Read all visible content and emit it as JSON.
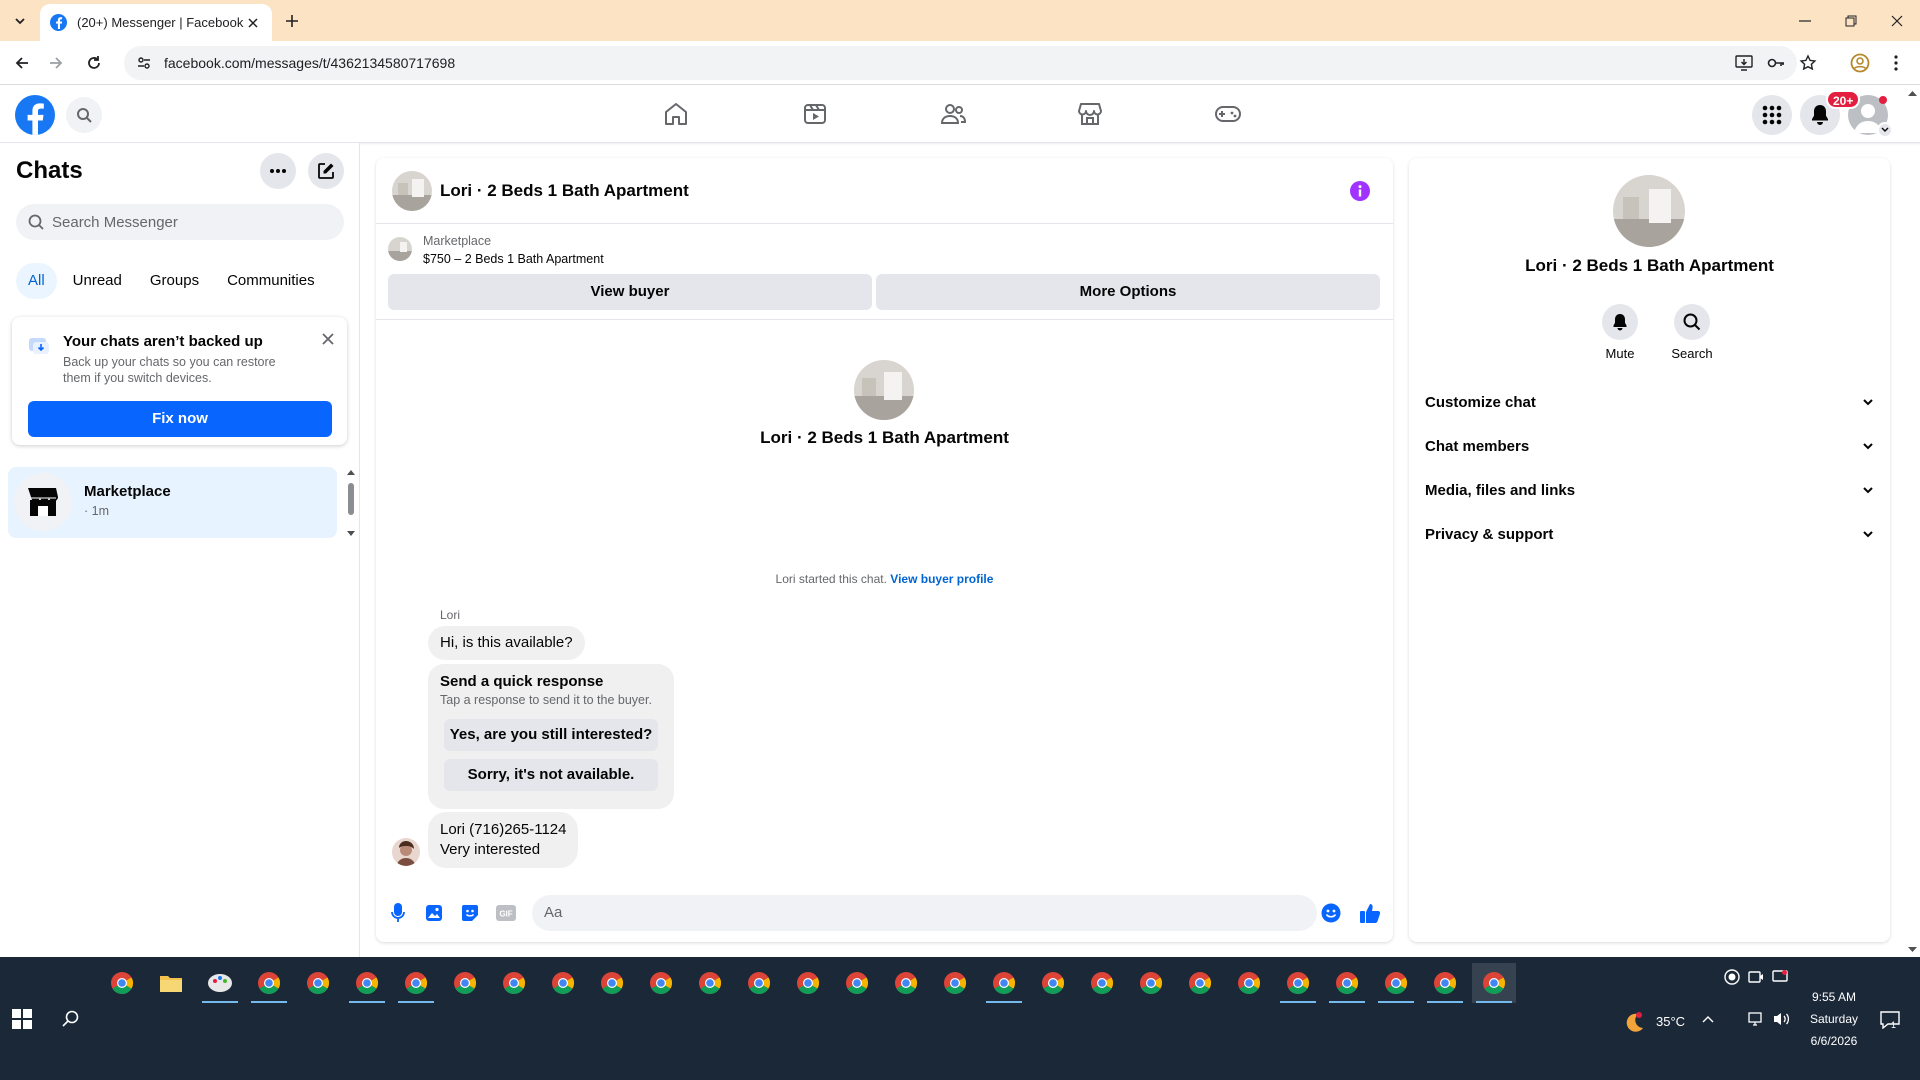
{
  "browser": {
    "tab_title": "(20+) Messenger | Facebook",
    "url": "facebook.com/messages/t/4362134580717698"
  },
  "header": {
    "notification_badge": "20+",
    "nav": [
      "home-icon",
      "video-icon",
      "friends-icon",
      "marketplace-icon",
      "gaming-icon"
    ],
    "accent_color": "#0866ff"
  },
  "sidebar": {
    "title": "Chats",
    "search_placeholder": "Search Messenger",
    "filters": [
      "All",
      "Unread",
      "Groups",
      "Communities"
    ],
    "backup": {
      "title": "Your chats aren’t backed up",
      "description": "Back up your chats so you can restore them if you switch devices.",
      "button": "Fix now"
    },
    "chats": [
      {
        "name": "Marketplace",
        "time": "· 1m"
      }
    ]
  },
  "conversation": {
    "title": "Lori · 2 Beds 1 Bath Apartment",
    "listing": {
      "label": "Marketplace",
      "price_title": "$750 – 2 Beds 1 Bath Apartment",
      "view_buyer": "View buyer",
      "more_options": "More Options"
    },
    "intro_name": "Lori · 2 Beds 1 Bath Apartment",
    "started_text": "Lori started this chat.",
    "started_link": "View buyer profile",
    "sender": "Lori",
    "message_1": "Hi, is this available?",
    "quick": {
      "title": "Send a quick response",
      "subtitle": "Tap a response to send it to the buyer.",
      "option_1": "Yes, are you still interested?",
      "option_2": "Sorry, it's not available."
    },
    "message_2_line1": "Lori (716)265-1124",
    "message_2_line2": "Very interested",
    "composer_placeholder": "Aa"
  },
  "details": {
    "name": "Lori · 2 Beds 1 Bath Apartment",
    "actions": [
      "Mute",
      "Search"
    ],
    "sections": [
      "Customize chat",
      "Chat members",
      "Media, files and links",
      "Privacy & support"
    ]
  },
  "taskbar": {
    "temperature": "35°C",
    "time": "9:55 AM",
    "day": "Saturday",
    "date": "6/6/2026",
    "notif_count": "1"
  }
}
